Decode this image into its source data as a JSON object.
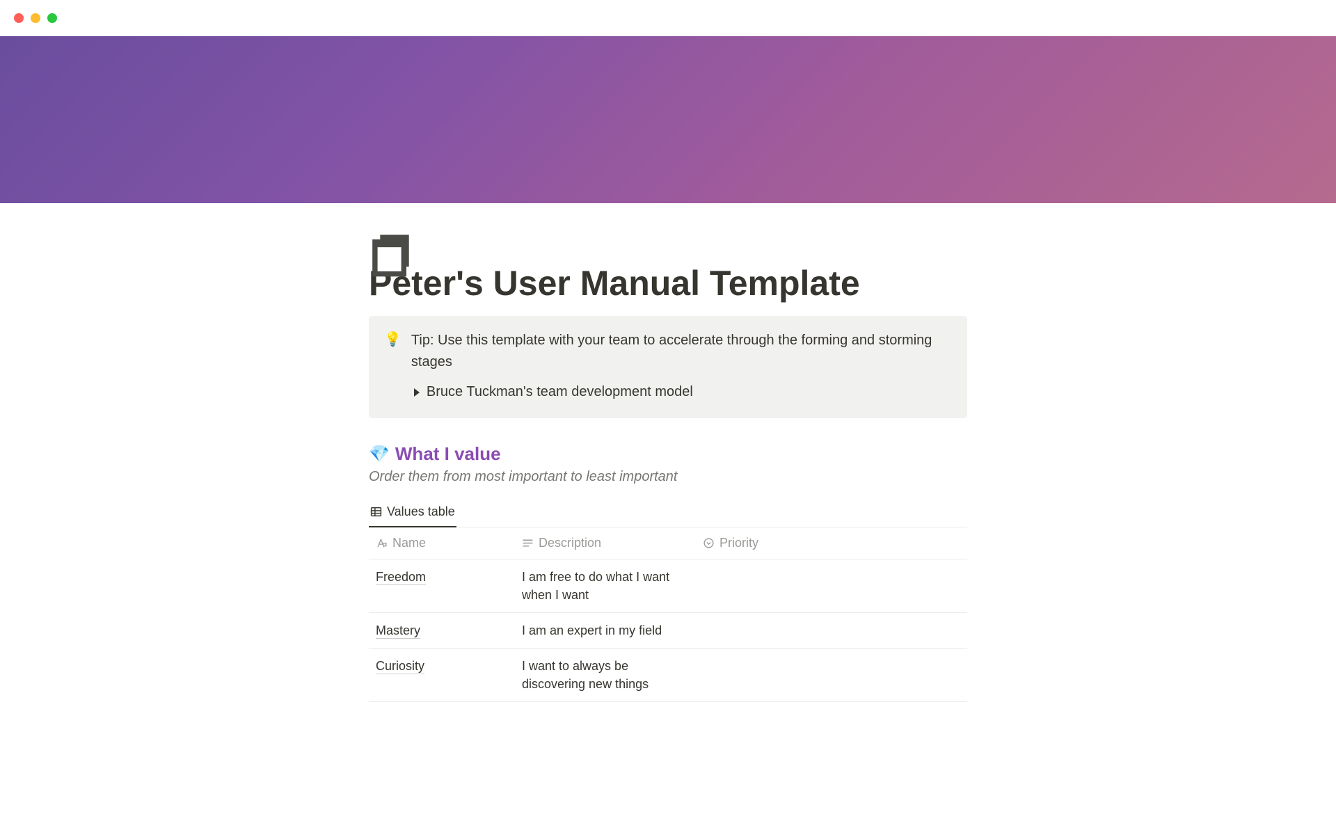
{
  "page": {
    "title": "Peter's User Manual Template"
  },
  "callout": {
    "icon": "💡",
    "text": "Tip: Use this template with your team to accelerate through the forming and storming stages",
    "toggle_label": "Bruce Tuckman's team development model"
  },
  "section": {
    "emoji": "💎",
    "heading": "What I value",
    "subtitle": "Order them from most important to least important"
  },
  "database": {
    "tab_label": "Values table",
    "columns": {
      "name": "Name",
      "description": "Description",
      "priority": "Priority"
    },
    "rows": [
      {
        "name": "Freedom",
        "description": "I am free to do what I want when I want",
        "priority": ""
      },
      {
        "name": "Mastery",
        "description": "I am an expert in my field",
        "priority": ""
      },
      {
        "name": "Curiosity",
        "description": "I want to always be discovering new things",
        "priority": ""
      }
    ]
  }
}
